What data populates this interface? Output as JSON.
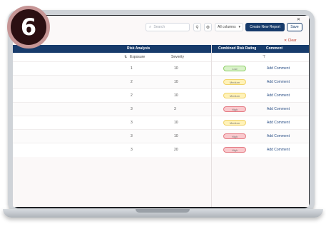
{
  "badge": {
    "number": "6"
  },
  "toolbar": {
    "search_placeholder": "Search",
    "dropdown_label": "All columns",
    "primary_label": "Create New Report",
    "outline_label": "Save",
    "clear_label": "Clear"
  },
  "table": {
    "group_headers": [
      "Risk Analysis",
      "Combined Risk Rating",
      "Comment"
    ],
    "sub_headers": [
      "Exposure",
      "Severity"
    ],
    "rows": [
      {
        "col1": "1",
        "col2": "10",
        "rating": "Low",
        "rating_color": "#d9f2c9",
        "rating_border": "#8fcf6a",
        "action": "Add Comment"
      },
      {
        "col1": "2",
        "col2": "10",
        "rating": "Medium",
        "rating_color": "#fff2b8",
        "rating_border": "#f1d36a",
        "action": "Add Comment"
      },
      {
        "col1": "2",
        "col2": "10",
        "rating": "Medium",
        "rating_color": "#fff2b8",
        "rating_border": "#f1d36a",
        "action": "Add Comment"
      },
      {
        "col1": "3",
        "col2": "3",
        "rating": "High",
        "rating_color": "#f9c9cd",
        "rating_border": "#e57b84",
        "action": "Add Comment"
      },
      {
        "col1": "3",
        "col2": "10",
        "rating": "Medium",
        "rating_color": "#fff2b8",
        "rating_border": "#f1d36a",
        "action": "Add Comment"
      },
      {
        "col1": "3",
        "col2": "10",
        "rating": "High",
        "rating_color": "#f9c9cd",
        "rating_border": "#e57b84",
        "action": "Add Comment"
      },
      {
        "col1": "3",
        "col2": "20",
        "rating": "High",
        "rating_color": "#f9c9cd",
        "rating_border": "#e57b84",
        "action": "Add Comment"
      }
    ]
  }
}
